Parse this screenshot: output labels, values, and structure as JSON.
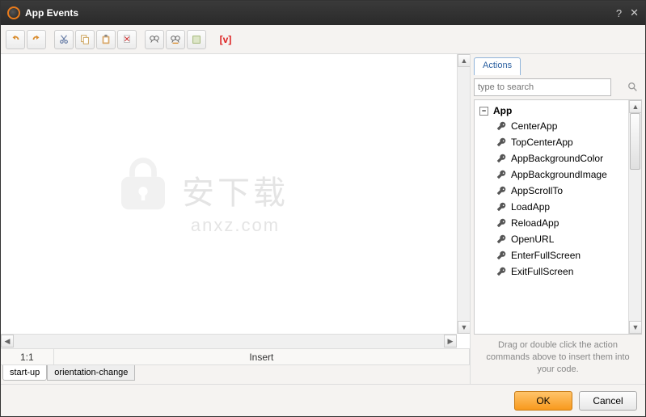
{
  "window": {
    "title": "App Events"
  },
  "toolbar": {
    "v_label": "[v]"
  },
  "status": {
    "position": "1:1",
    "mode": "Insert"
  },
  "event_tabs": {
    "items": [
      {
        "label": "start-up"
      },
      {
        "label": "orientation-change"
      }
    ]
  },
  "side": {
    "tab_label": "Actions",
    "search_placeholder": "type to search",
    "category": "App",
    "toggle_glyph": "−",
    "items": [
      {
        "label": "CenterApp"
      },
      {
        "label": "TopCenterApp"
      },
      {
        "label": "AppBackgroundColor"
      },
      {
        "label": "AppBackgroundImage"
      },
      {
        "label": "AppScrollTo"
      },
      {
        "label": "LoadApp"
      },
      {
        "label": "ReloadApp"
      },
      {
        "label": "OpenURL"
      },
      {
        "label": "EnterFullScreen"
      },
      {
        "label": "ExitFullScreen"
      }
    ],
    "hint": "Drag or double click the action commands above to insert them into your code."
  },
  "buttons": {
    "ok": "OK",
    "cancel": "Cancel"
  },
  "watermark": {
    "cn": "安下载",
    "en": "anxz.com"
  }
}
